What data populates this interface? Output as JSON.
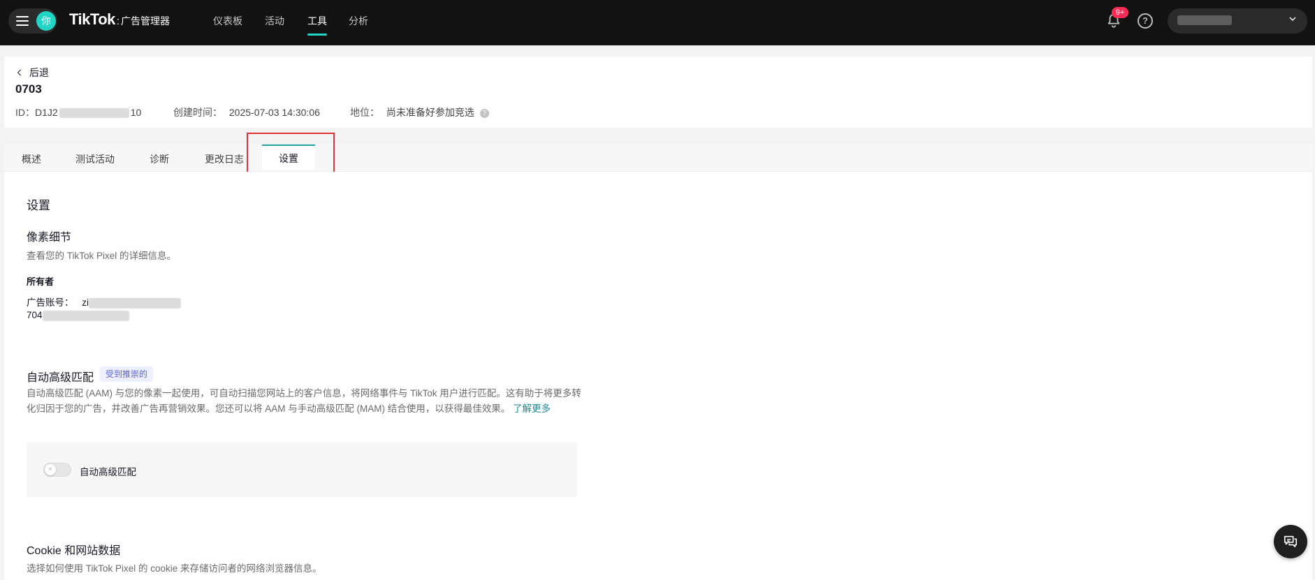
{
  "topbar": {
    "avatar_text": "你",
    "logo_main": "TikTok",
    "logo_colon": ":",
    "logo_sub": "广告管理器",
    "nav": [
      {
        "label": "仪表板",
        "active": false
      },
      {
        "label": "活动",
        "active": false
      },
      {
        "label": "工具",
        "active": true
      },
      {
        "label": "分析",
        "active": false
      }
    ],
    "notification_badge": "9+",
    "help_glyph": "?"
  },
  "header": {
    "back_label": "后退",
    "title": "0703",
    "id_label": "ID：",
    "id_prefix": "D1J2",
    "id_suffix": "10",
    "created_label": "创建时间：",
    "created_value": "2025-07-03 14:30:06",
    "status_label": "地位：",
    "status_value": "尚未准备好参加竞选"
  },
  "tabs": [
    {
      "label": "概述"
    },
    {
      "label": "测试活动"
    },
    {
      "label": "诊断"
    },
    {
      "label": "更改日志"
    },
    {
      "label": "设置",
      "active": true
    }
  ],
  "content": {
    "title": "设置",
    "pixel_details": {
      "title": "像素细节",
      "desc": "查看您的 TikTok Pixel 的详细信息。",
      "owner_label": "所有者",
      "account_label": "广告账号：",
      "account_name_prefix": "zi",
      "account_id_prefix": "704"
    },
    "aam": {
      "title": "自动高级匹配",
      "tag": "受到推崇的",
      "desc": "自动高级匹配 (AAM) 与您的像素一起使用，可自动扫描您网站上的客户信息，将网络事件与 TikTok 用户进行匹配。这有助于将更多转化归因于您的广告，并改善广告再营销效果。您还可以将 AAM 与手动高级匹配 (MAM) 结合使用，以获得最佳效果。",
      "learn_more": "了解更多",
      "switch_label": "自动高级匹配",
      "switch_on": false
    },
    "cookie": {
      "title": "Cookie 和网站数据",
      "desc": "选择如何使用 TikTok Pixel 的 cookie 来存储访问者的网络浏览器信息。"
    }
  },
  "colors": {
    "accent": "#20d5c6",
    "tab_active": "#20a0a8",
    "badge": "#fe2c55",
    "highlight": "#e03434",
    "link": "#1a8a96"
  },
  "icons": [
    "menu-icon",
    "bell-icon",
    "help-icon",
    "chevron-down-icon",
    "chevron-left-icon",
    "question-icon",
    "chat-icon"
  ]
}
